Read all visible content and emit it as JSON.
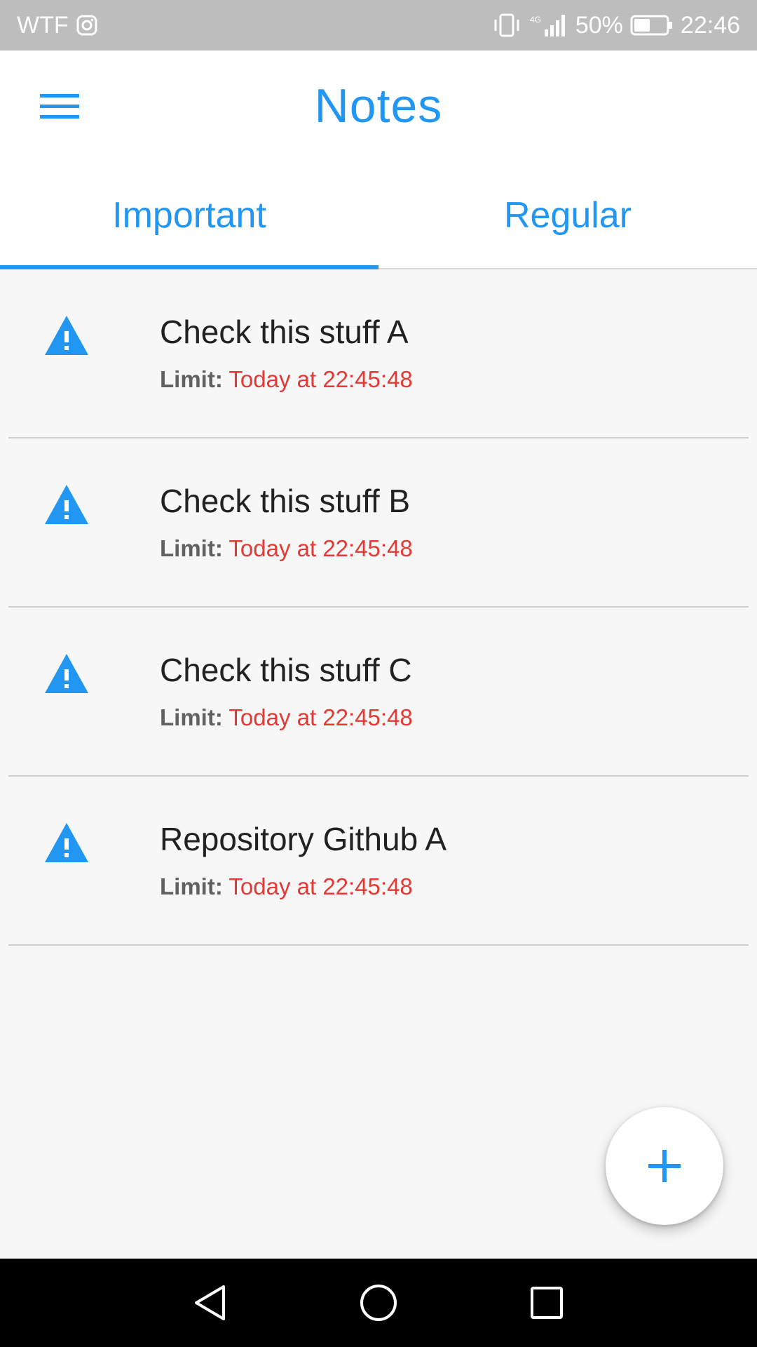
{
  "status_bar": {
    "carrier": "WTF",
    "battery": "50%",
    "time": "22:46",
    "network_label": "4G",
    "icons": [
      "instagram-icon",
      "vibrate-icon",
      "signal-icon",
      "battery-icon"
    ]
  },
  "app_bar": {
    "title": "Notes",
    "menu_icon": "hamburger-menu-icon"
  },
  "tabs": [
    {
      "label": "Important",
      "selected": true
    },
    {
      "label": "Regular",
      "selected": false
    }
  ],
  "notes": [
    {
      "title": "Check this stuff A",
      "limit_label": "Limit:",
      "limit_value": "Today at 22:45:48",
      "icon": "warning-icon"
    },
    {
      "title": "Check this stuff B",
      "limit_label": "Limit:",
      "limit_value": "Today at 22:45:48",
      "icon": "warning-icon"
    },
    {
      "title": "Check this stuff C",
      "limit_label": "Limit:",
      "limit_value": "Today at 22:45:48",
      "icon": "warning-icon"
    },
    {
      "title": "Repository Github A",
      "limit_label": "Limit:",
      "limit_value": "Today at 22:45:48",
      "icon": "warning-icon"
    }
  ],
  "fab": {
    "icon": "plus-icon"
  },
  "nav_bar": {
    "icons": [
      "back-icon",
      "home-icon",
      "recents-icon"
    ]
  },
  "colors": {
    "accent": "#2196f3",
    "limit_value": "#e53935",
    "status_bar": "#bdbdbd",
    "background": "#f7f7f7"
  }
}
